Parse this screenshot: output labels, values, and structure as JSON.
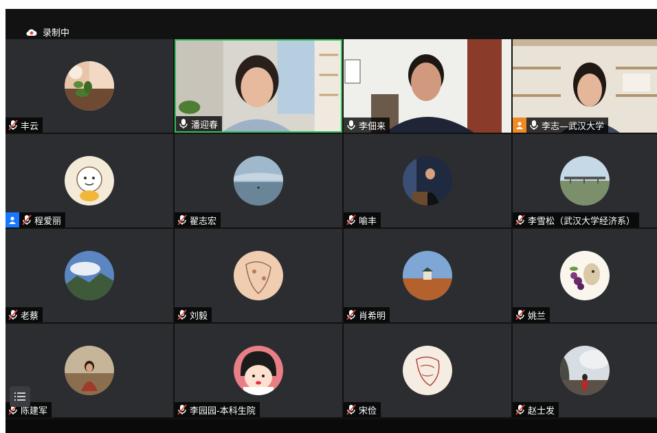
{
  "recording": {
    "label": "录制中"
  },
  "participants": [
    {
      "name": "丰云",
      "mic": "muted"
    },
    {
      "name": "潘迎春",
      "mic": "on"
    },
    {
      "name": "李佃来",
      "mic": "on"
    },
    {
      "name": "李志—武汉大学",
      "mic": "on"
    },
    {
      "name": "程爱丽",
      "mic": "muted"
    },
    {
      "name": "翟志宏",
      "mic": "muted"
    },
    {
      "name": "喻丰",
      "mic": "muted"
    },
    {
      "name": "李雪松（武汉大学经济系）",
      "mic": "muted"
    },
    {
      "name": "老蔡",
      "mic": "muted"
    },
    {
      "name": "刘毅",
      "mic": "muted"
    },
    {
      "name": "肖希明",
      "mic": "muted"
    },
    {
      "name": "姚兰",
      "mic": "muted"
    },
    {
      "name": "陈建军",
      "mic": "muted"
    },
    {
      "name": "李园园-本科生院",
      "mic": "muted"
    },
    {
      "name": "宋俭",
      "mic": "muted"
    },
    {
      "name": "赵士发",
      "mic": "muted"
    }
  ],
  "colors": {
    "speaking_border": "#2fbf5a",
    "host_badge": "#1677ff",
    "muted_mic": "#e0453a",
    "record_dot": "#e8443a"
  }
}
